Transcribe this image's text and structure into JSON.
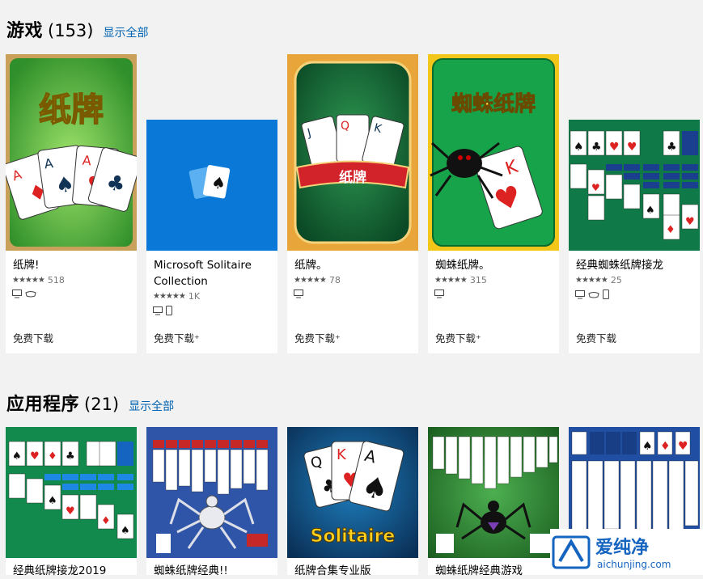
{
  "games_section": {
    "title": "游戏",
    "count": "(153)",
    "show_all": "显示全部"
  },
  "apps_section": {
    "title": "应用程序",
    "count": "(21)",
    "show_all": "显示全部"
  },
  "game_cards": [
    {
      "name": "纸牌!",
      "stars": "★★★★★",
      "rating_count": "518",
      "price": "免费下载",
      "art_title": "纸牌"
    },
    {
      "name": "Microsoft Solitaire Collection",
      "stars": "★★★★★",
      "rating_count": "1K",
      "price": "免费下载⁺"
    },
    {
      "name": "纸牌。",
      "stars": "★★★★★",
      "rating_count": "78",
      "price": "免费下载⁺",
      "art_title": "纸牌"
    },
    {
      "name": "蜘蛛纸牌。",
      "stars": "★★★★★",
      "rating_count": "315",
      "price": "免费下载⁺",
      "art_title": "蜘蛛纸牌"
    },
    {
      "name": "经典蜘蛛纸牌接龙",
      "stars": "★★★★★",
      "rating_count": "25",
      "price": "免费下载"
    }
  ],
  "app_cards": [
    {
      "name": "经典纸牌接龙2019"
    },
    {
      "name": "蜘蛛纸牌经典!!"
    },
    {
      "name": "纸牌合集专业版",
      "art_title": "Solitaire"
    },
    {
      "name": "蜘蛛纸牌经典游戏"
    },
    {
      "name": ""
    }
  ],
  "watermark": {
    "brand": "爱纯净",
    "url": "aichunjing.com"
  },
  "colors": {
    "accent": "#0063b1",
    "card_bg": "#ffffff",
    "page_bg": "#f2f2f2"
  }
}
